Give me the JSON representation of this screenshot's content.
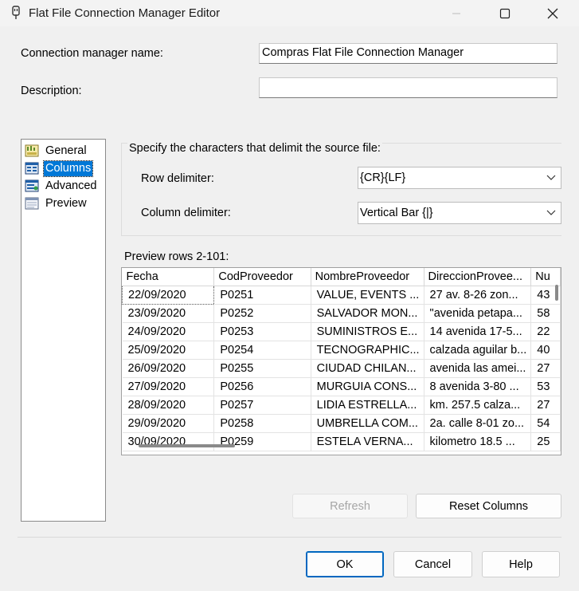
{
  "window": {
    "title": "Flat File Connection Manager Editor"
  },
  "form": {
    "name_label": "Connection manager name:",
    "name_value": "Compras Flat File Connection Manager",
    "description_label": "Description:",
    "description_value": ""
  },
  "nav": {
    "items": [
      {
        "label": "General",
        "icon": "general-icon"
      },
      {
        "label": "Columns",
        "icon": "columns-icon",
        "selected": true
      },
      {
        "label": "Advanced",
        "icon": "advanced-icon"
      },
      {
        "label": "Preview",
        "icon": "preview-icon"
      }
    ]
  },
  "delimiters": {
    "heading": "Specify the characters that delimit the source file:",
    "row_label": "Row delimiter:",
    "row_value": "{CR}{LF}",
    "column_label": "Column delimiter:",
    "column_value": "Vertical Bar {|}"
  },
  "preview": {
    "heading": "Preview rows 2-101:",
    "columns": [
      "Fecha",
      "CodProveedor",
      "NombreProveedor",
      "DireccionProvee...",
      "Nu"
    ],
    "rows": [
      [
        "22/09/2020",
        "P0251",
        "VALUE, EVENTS ...",
        "27 av. 8-26 zon...",
        "43"
      ],
      [
        "23/09/2020",
        "P0252",
        "SALVADOR MON...",
        "\"avenida petapa...",
        "58"
      ],
      [
        "24/09/2020",
        "P0253",
        "SUMINISTROS E...",
        "14 avenida 17-5...",
        "22"
      ],
      [
        "25/09/2020",
        "P0254",
        "TECNOGRAPHIC...",
        "calzada aguilar b...",
        "40"
      ],
      [
        "26/09/2020",
        "P0255",
        "CIUDAD CHILAN...",
        "avenida las amei...",
        "27"
      ],
      [
        "27/09/2020",
        "P0256",
        "MURGUIA CONS...",
        "8 avenida 3-80 ...",
        "53"
      ],
      [
        "28/09/2020",
        "P0257",
        "LIDIA ESTRELLA...",
        "km. 257.5 calza...",
        "27"
      ],
      [
        "29/09/2020",
        "P0258",
        "UMBRELLA COM...",
        "2a. calle 8-01 zo...",
        "54"
      ],
      [
        "30/09/2020",
        "P0259",
        "ESTELA VERNA...",
        "kilometro 18.5 ...",
        "25"
      ]
    ]
  },
  "buttons": {
    "refresh": "Refresh",
    "reset_columns": "Reset Columns",
    "ok": "OK",
    "cancel": "Cancel",
    "help": "Help"
  },
  "colors": {
    "selection": "#0078d7",
    "default_button_border": "#0067c0"
  }
}
